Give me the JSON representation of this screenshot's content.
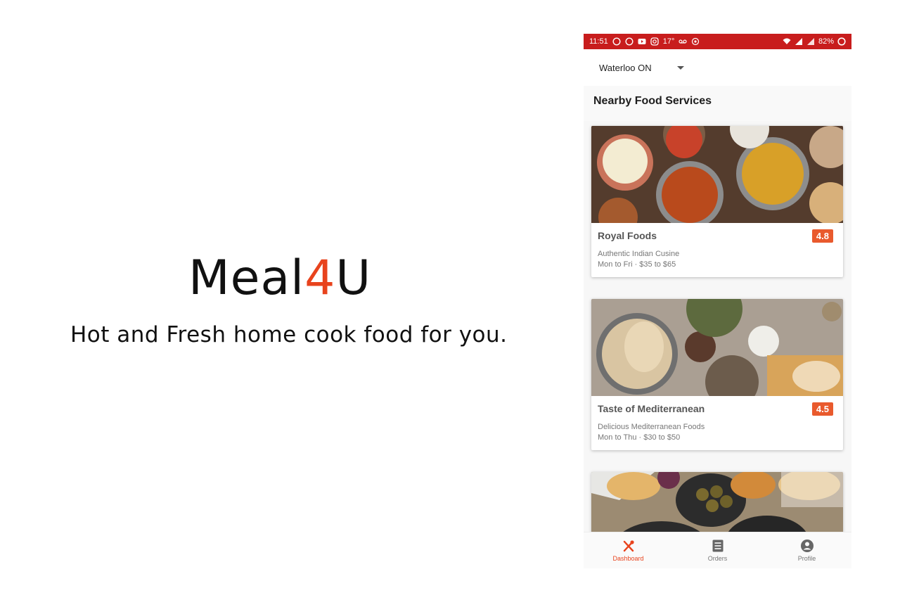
{
  "promo": {
    "logo_main": "Meal",
    "logo_accent": "4",
    "logo_end": "U",
    "tagline": "Hot and Fresh home cook food for you."
  },
  "statusbar": {
    "time": "11:51",
    "temperature": "17°",
    "battery": "82%",
    "color": "#c81d1d"
  },
  "location": {
    "value": "Waterloo ON"
  },
  "section": {
    "title": "Nearby Food Services"
  },
  "services": [
    {
      "name": "Royal Foods",
      "rating": "4.8",
      "description": "Authentic Indian Cusine",
      "schedule": "Mon to Fri  ·  $35 to $65",
      "image": "indian-food-photo"
    },
    {
      "name": "Taste of Mediterranean",
      "rating": "4.5",
      "description": "Delicious Mediterranean Foods",
      "schedule": "Mon to Thu  ·  $30 to $50",
      "image": "mediterranean-food-photo"
    },
    {
      "image": "falafel-food-photo"
    }
  ],
  "bottom_nav": [
    {
      "label": "Dashboard",
      "icon": "utensils-icon",
      "active": true
    },
    {
      "label": "Orders",
      "icon": "list-icon",
      "active": false
    },
    {
      "label": "Profile",
      "icon": "account-icon",
      "active": false
    }
  ],
  "colors": {
    "accent": "#e8431d",
    "rating_badge": "#e95a2d"
  }
}
